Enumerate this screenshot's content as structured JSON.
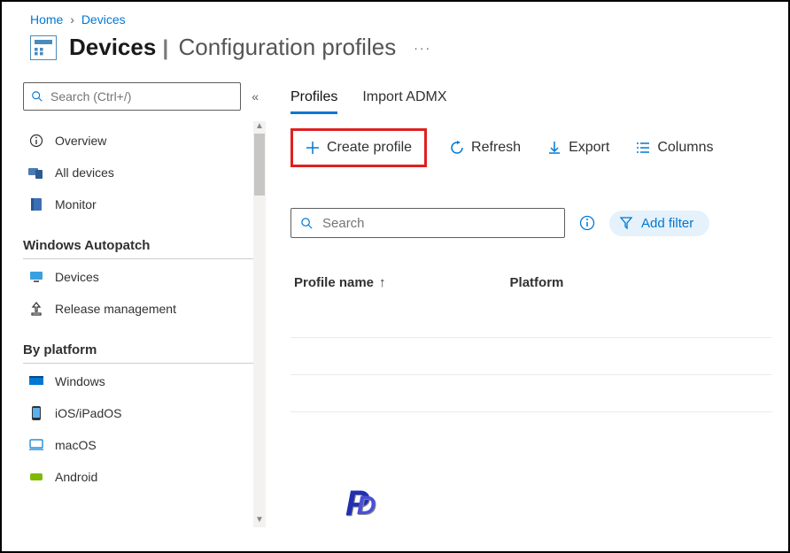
{
  "breadcrumb": {
    "home": "Home",
    "devices": "Devices"
  },
  "header": {
    "title": "Devices",
    "subtitle": "Configuration profiles",
    "more": "···"
  },
  "sidebar": {
    "search_placeholder": "Search (Ctrl+/)",
    "groups": [
      {
        "items": [
          {
            "id": "overview",
            "label": "Overview",
            "icon": "info-icon"
          },
          {
            "id": "all-devices",
            "label": "All devices",
            "icon": "devices-icon"
          },
          {
            "id": "monitor",
            "label": "Monitor",
            "icon": "book-icon"
          }
        ]
      },
      {
        "heading": "Windows Autopatch",
        "items": [
          {
            "id": "ap-devices",
            "label": "Devices",
            "icon": "monitor-icon"
          },
          {
            "id": "release-mgmt",
            "label": "Release management",
            "icon": "upload-icon"
          }
        ]
      },
      {
        "heading": "By platform",
        "items": [
          {
            "id": "windows",
            "label": "Windows",
            "icon": "windows-icon"
          },
          {
            "id": "ios",
            "label": "iOS/iPadOS",
            "icon": "ios-icon"
          },
          {
            "id": "macos",
            "label": "macOS",
            "icon": "mac-icon"
          },
          {
            "id": "android",
            "label": "Android",
            "icon": "android-icon"
          }
        ]
      }
    ]
  },
  "main": {
    "tabs": [
      {
        "id": "profiles",
        "label": "Profiles",
        "active": true
      },
      {
        "id": "import",
        "label": "Import ADMX",
        "active": false
      }
    ],
    "toolbar": {
      "create": "Create profile",
      "refresh": "Refresh",
      "export": "Export",
      "columns": "Columns"
    },
    "search_placeholder": "Search",
    "add_filter": "Add filter",
    "columns": {
      "profile_name": "Profile name",
      "platform": "Platform"
    }
  }
}
